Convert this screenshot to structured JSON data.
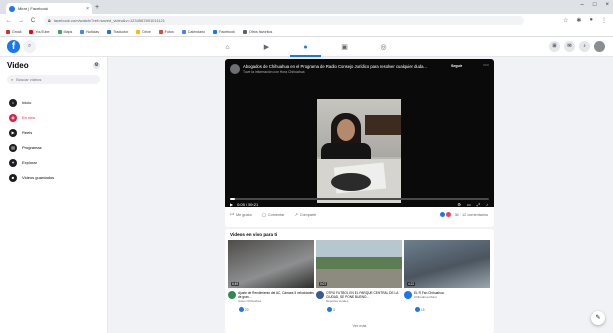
{
  "browser": {
    "tab_title": "Mirar | Facebook",
    "tab_close": "×",
    "new_tab": "+",
    "window_controls": [
      "–",
      "□",
      "×"
    ],
    "back": "←",
    "forward": "→",
    "reload": "C",
    "home": "⌂",
    "url": "facebook.com/watch/?ref=saved_video&v=1234567891011121",
    "bookmarks": [
      {
        "label": "Gmail",
        "color": "#d93025"
      },
      {
        "label": "YouTube",
        "color": "#ff0000"
      },
      {
        "label": "Maps",
        "color": "#34a853"
      },
      {
        "label": "Noticias",
        "color": "#4285f4"
      },
      {
        "label": "Traductor",
        "color": "#1a73e8"
      },
      {
        "label": "Drive",
        "color": "#fbbc04"
      },
      {
        "label": "Fotos",
        "color": "#ea4335"
      },
      {
        "label": "Calendario",
        "color": "#4285f4"
      },
      {
        "label": "Facebook",
        "color": "#1877f2"
      },
      {
        "label": "Otros favoritos",
        "color": "#5f6368"
      }
    ]
  },
  "header": {
    "logo": "f",
    "nav_icons": [
      "⌂",
      "▶",
      "▣",
      "☐",
      "◎"
    ]
  },
  "sidebar": {
    "title": "Video",
    "search_placeholder": "Buscar videos",
    "items": [
      {
        "label": "Inicio",
        "icon": "home-icon",
        "glyph": "⌂"
      },
      {
        "label": "En vivo",
        "icon": "live-icon",
        "glyph": "◉"
      },
      {
        "label": "Reels",
        "icon": "reels-icon",
        "glyph": "▶"
      },
      {
        "label": "Programas",
        "icon": "shows-icon",
        "glyph": "▤"
      },
      {
        "label": "Explorar",
        "icon": "explore-icon",
        "glyph": "✦"
      },
      {
        "label": "Videos guardados",
        "icon": "saved-icon",
        "glyph": "■"
      }
    ]
  },
  "video": {
    "title": "Abogados de Chihuahua en el Programa de Radio Consejo Jurídico para resolver cualquier duda...",
    "subtitle": "Tuve la información con Hora Chihuahua",
    "follow": "Seguir",
    "time": "0:05 / 59:21",
    "progress": 0.02,
    "actions": {
      "like": "Me gusta",
      "comment": "Comentar",
      "share": "Compartir"
    },
    "reactions_count": "36 · 12 comentarios"
  },
  "suggestions": {
    "title": "Videos en vivo para ti",
    "items": [
      {
        "duration": "6:49",
        "title": "Ajuste de Rendimiento del AC, Cámara 5 velocidades de gran...",
        "channel": "Autos Chihuahua",
        "reacts": "20",
        "avatar_color": "#2e8b57"
      },
      {
        "duration": "0:07",
        "title": "OTRO FUTBOL EN EL PARQUE CENTRAL DE LA CIUDAD, SE PONE BUENO...",
        "channel": "Deportes locales",
        "reacts": "3",
        "avatar_color": "#3b5998"
      },
      {
        "duration": "4:22",
        "title": "EL R Fan Chihuahua",
        "channel": "Chihuahua Motor",
        "reacts": "15",
        "avatar_color": "#1877f2"
      }
    ],
    "see_more": "Ver más"
  }
}
